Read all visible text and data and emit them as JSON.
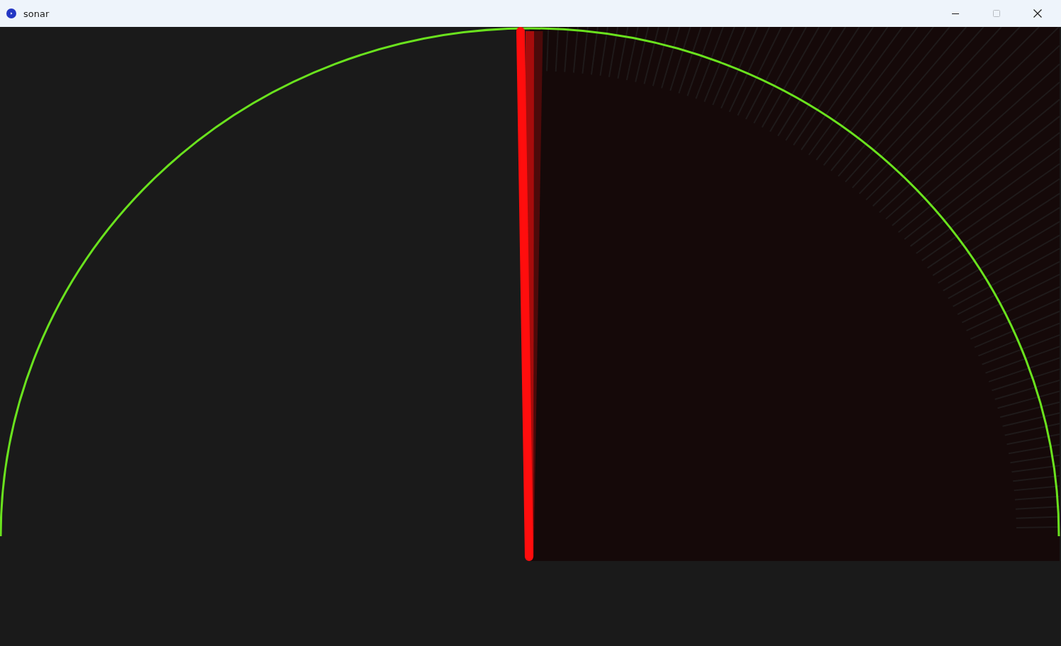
{
  "window": {
    "title": "sonar"
  }
}
